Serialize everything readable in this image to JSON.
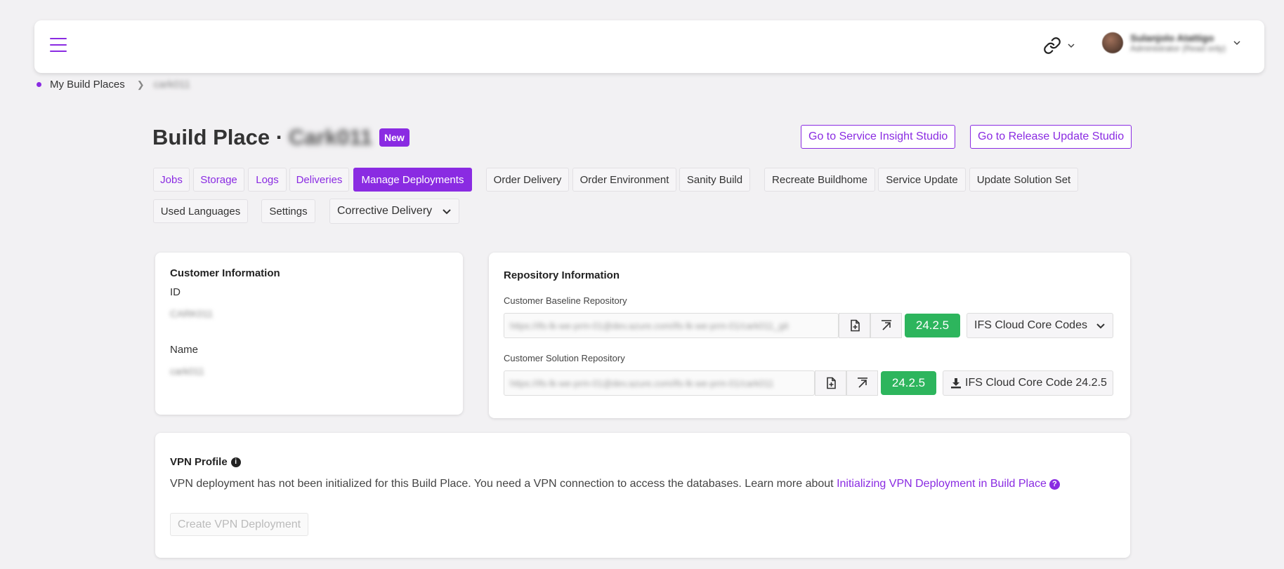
{
  "header": {
    "menu_icon": "hamburger-icon",
    "link_icon": "link-icon",
    "user": {
      "name": "Sulanjolo Atattigo",
      "role": "Administrator (Read only)"
    }
  },
  "breadcrumb": {
    "root": "My Build Places",
    "current": "cark011"
  },
  "page": {
    "title": "Build Place ·",
    "title_blurred": "Cark011",
    "badge": "New"
  },
  "actions": {
    "service_insight": "Go to Service Insight Studio",
    "release_update": "Go to Release Update Studio"
  },
  "nav": {
    "jobs": "Jobs",
    "storage": "Storage",
    "logs": "Logs",
    "deliveries": "Deliveries",
    "manage_deployments": "Manage Deployments",
    "order_delivery": "Order Delivery",
    "order_environment": "Order Environment",
    "sanity_build": "Sanity Build",
    "recreate_buildhome": "Recreate Buildhome",
    "service_update": "Service Update",
    "update_solution_set": "Update Solution Set",
    "used_languages": "Used Languages",
    "settings": "Settings",
    "corrective_delivery": "Corrective Delivery"
  },
  "customer": {
    "title": "Customer Information",
    "id_label": "ID",
    "id_value": "CARK011",
    "name_label": "Name",
    "name_value": "cark011"
  },
  "repository": {
    "title": "Repository Information",
    "baseline_label": "Customer Baseline Repository",
    "baseline_url": "https://ifs-lk-we-prm-01@dev.azure.com/ifs-lk-we-prm-01/cark011_git",
    "baseline_version": "24.2.5",
    "baseline_dropdown": "IFS Cloud Core Codes",
    "solution_label": "Customer Solution Repository",
    "solution_url": "https://ifs-lk-we-prm-01@dev.azure.com/ifs-lk-we-prm-01/cark011",
    "solution_version": "24.2.5",
    "solution_download": "IFS Cloud Core Code 24.2.5"
  },
  "vpn": {
    "title": "VPN Profile",
    "description": "VPN deployment has not been initialized for this Build Place. You need a VPN connection to access the databases. Learn more about",
    "link": "Initializing VPN Deployment in Build Place",
    "button": "Create VPN Deployment"
  },
  "colors": {
    "accent": "#8a2be2",
    "version_badge": "#2db55d",
    "background": "#f2f1f3"
  }
}
